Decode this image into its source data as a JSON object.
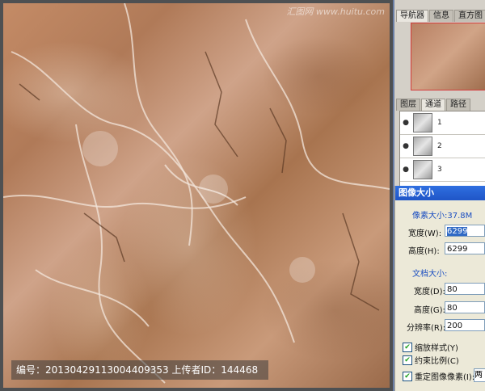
{
  "watermark": {
    "text": "编号：20130429113004409353 上传者ID：144468",
    "site": "汇图网 www.huitu.com"
  },
  "panels": {
    "top_tabs": [
      "导航器",
      "信息",
      "直方图"
    ],
    "mid_tabs": [
      "图层",
      "通道",
      "路径"
    ],
    "channels": [
      {
        "label": "1",
        "eye": "eye-icon"
      },
      {
        "label": "2",
        "eye": "eye-icon"
      },
      {
        "label": "3",
        "eye": "eye-icon"
      }
    ]
  },
  "dialog": {
    "title": "图像大小",
    "pixel_section": "像素大小:37.8M",
    "width_label": "宽度(W):",
    "width_value": "6299",
    "height_label": "高度(H):",
    "height_value": "6299",
    "doc_section": "文档大小:",
    "doc_width_label": "宽度(D):",
    "doc_width_value": "80",
    "doc_height_label": "高度(G):",
    "doc_height_value": "80",
    "resolution_label": "分辨率(R):",
    "resolution_value": "200",
    "scale_styles": "缩放样式(Y)",
    "constrain": "约束比例(C)",
    "resample": "重定图像像素(I):",
    "resample_method": "两次"
  },
  "colors": {
    "title_bar": "#1f55c7",
    "selection": "#316ac5",
    "panel_bg": "#d4d0c8",
    "dialog_bg": "#ece9d8"
  }
}
